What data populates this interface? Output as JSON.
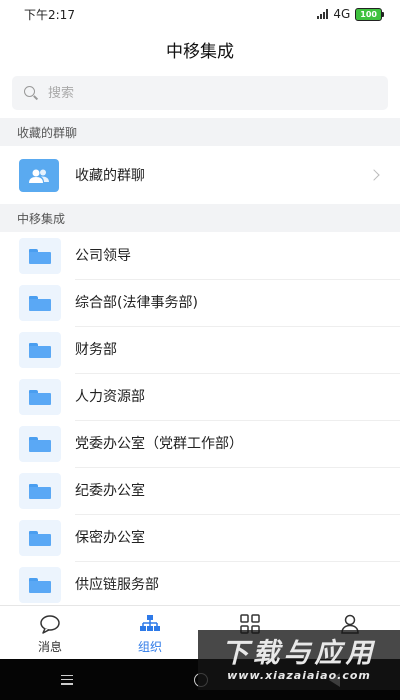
{
  "status": {
    "time": "下午2:17",
    "network": "4G",
    "battery": "100"
  },
  "header": {
    "title": "中移集成"
  },
  "search": {
    "placeholder": "搜索"
  },
  "sections": {
    "favorites": {
      "title": "收藏的群聊",
      "item_label": "收藏的群聊"
    },
    "org": {
      "title": "中移集成"
    }
  },
  "org_items": [
    {
      "label": "公司领导"
    },
    {
      "label": "综合部(法律事务部)"
    },
    {
      "label": "财务部"
    },
    {
      "label": "人力资源部"
    },
    {
      "label": "党委办公室（党群工作部）"
    },
    {
      "label": "纪委办公室"
    },
    {
      "label": "保密办公室"
    },
    {
      "label": "供应链服务部"
    }
  ],
  "tabs": [
    {
      "label": "消息",
      "icon": "chat-bubble-icon"
    },
    {
      "label": "组织",
      "icon": "org-chart-icon",
      "active": true
    },
    {
      "label": "",
      "icon": "grid-icon"
    },
    {
      "label": "",
      "icon": "person-icon"
    }
  ],
  "watermark": {
    "title": "下载与应用",
    "url": "www.xiazaiaiao.com"
  },
  "colors": {
    "accent": "#2e7ae8",
    "folder": "#5aa8f5",
    "section_bg": "#f2f3f5"
  }
}
